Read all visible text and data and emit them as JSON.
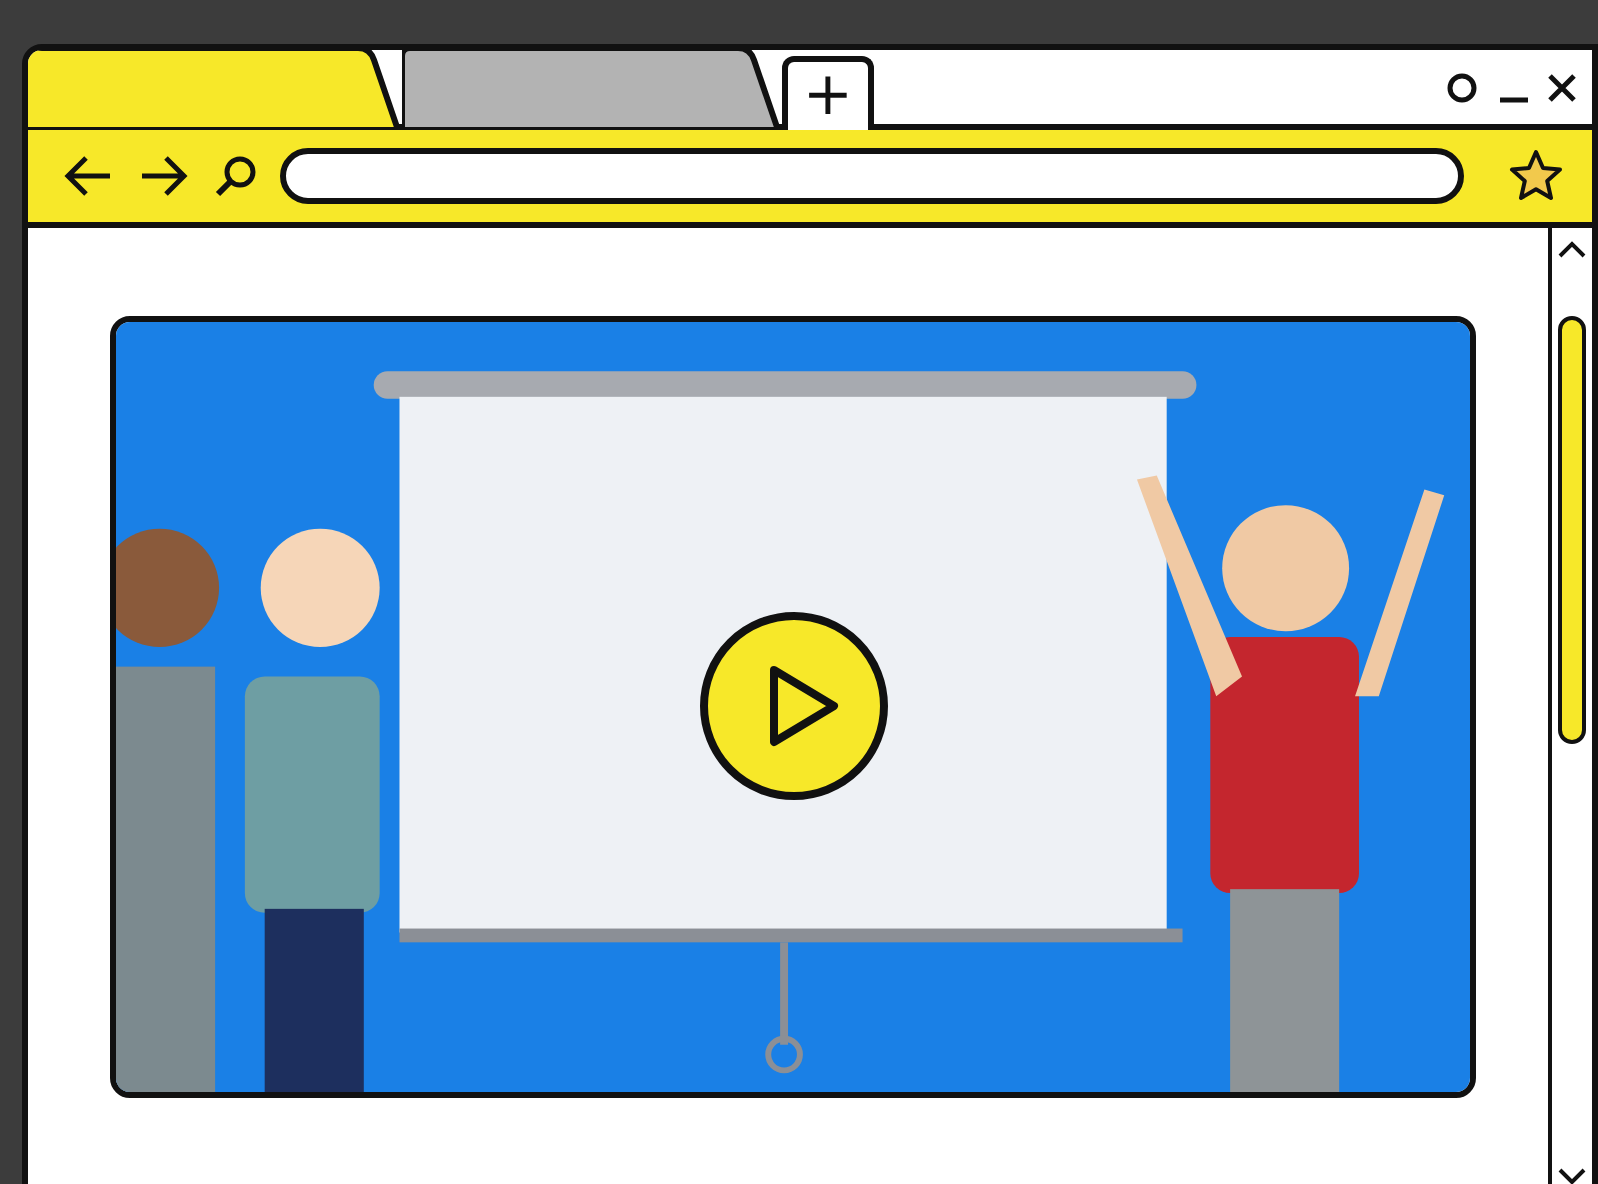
{
  "browser": {
    "tabs": [
      {
        "selected": true
      },
      {
        "selected": false
      }
    ],
    "new_tab": "+"
  },
  "video": {
    "kind": "picture",
    "play_button": true
  }
}
